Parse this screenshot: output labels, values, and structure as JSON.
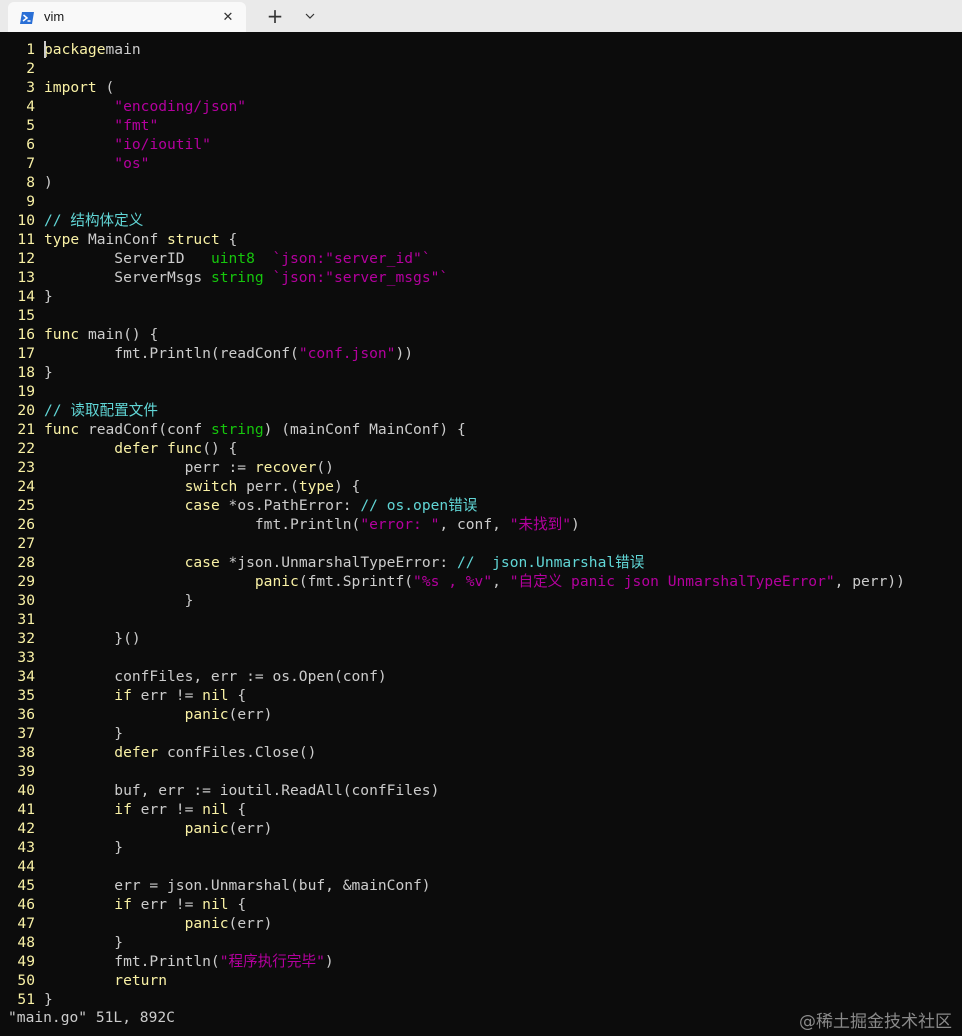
{
  "window": {
    "tab_title": "vim",
    "tab_icon": "powershell-icon",
    "close_glyph": "✕",
    "new_tab_glyph": "+",
    "dropdown_icon": "chevron-down-icon"
  },
  "colors": {
    "background": "#0c0c0c",
    "foreground": "#cccccc",
    "line_number": "#f9f1a5",
    "keyword": "#f9f1a5",
    "string": "#b4009e",
    "type": "#16c60c",
    "comment": "#61d6d6",
    "titlebar": "#eaeaea"
  },
  "editor": {
    "file_status": "\"main.go\" 51L, 892C",
    "lines": [
      [
        [
          "kw",
          "package"
        ],
        [
          "",
          "main"
        ]
      ],
      [],
      [
        [
          "kw",
          "import"
        ],
        [
          "",
          " ("
        ]
      ],
      [
        [
          "",
          "\t"
        ],
        [
          "str",
          "\"encoding/json\""
        ]
      ],
      [
        [
          "",
          "\t"
        ],
        [
          "str",
          "\"fmt\""
        ]
      ],
      [
        [
          "",
          "\t"
        ],
        [
          "str",
          "\"io/ioutil\""
        ]
      ],
      [
        [
          "",
          "\t"
        ],
        [
          "str",
          "\"os\""
        ]
      ],
      [
        [
          "",
          ")"
        ]
      ],
      [],
      [
        [
          "cm",
          "// 结构体定义"
        ]
      ],
      [
        [
          "kw",
          "type"
        ],
        [
          "",
          " MainConf "
        ],
        [
          "kw",
          "struct"
        ],
        [
          "",
          " {"
        ]
      ],
      [
        [
          "",
          "\tServerID   "
        ],
        [
          "ty",
          "uint8"
        ],
        [
          "",
          "  "
        ],
        [
          "str",
          "`json:\"server_id\"`"
        ]
      ],
      [
        [
          "",
          "\tServerMsgs "
        ],
        [
          "ty",
          "string"
        ],
        [
          "",
          " "
        ],
        [
          "str",
          "`json:\"server_msgs\"`"
        ]
      ],
      [
        [
          "",
          "}"
        ]
      ],
      [],
      [
        [
          "kw",
          "func"
        ],
        [
          "",
          " main() {"
        ]
      ],
      [
        [
          "",
          "\tfmt.Println(readConf("
        ],
        [
          "str",
          "\"conf.json\""
        ],
        [
          "",
          "))"
        ]
      ],
      [
        [
          "",
          "}"
        ]
      ],
      [],
      [
        [
          "cm",
          "// 读取配置文件"
        ]
      ],
      [
        [
          "kw",
          "func"
        ],
        [
          "",
          " readConf(conf "
        ],
        [
          "ty",
          "string"
        ],
        [
          "",
          ") (mainConf MainConf) {"
        ]
      ],
      [
        [
          "",
          "\t"
        ],
        [
          "kw",
          "defer"
        ],
        [
          "",
          " "
        ],
        [
          "kw",
          "func"
        ],
        [
          "",
          "() {"
        ]
      ],
      [
        [
          "",
          "\t\tperr := "
        ],
        [
          "kw",
          "recover"
        ],
        [
          "",
          "()"
        ]
      ],
      [
        [
          "",
          "\t\t"
        ],
        [
          "kw",
          "switch"
        ],
        [
          "",
          " perr.("
        ],
        [
          "kw",
          "type"
        ],
        [
          "",
          ") {"
        ]
      ],
      [
        [
          "",
          "\t\t"
        ],
        [
          "kw",
          "case"
        ],
        [
          "",
          " *os.PathError: "
        ],
        [
          "cm",
          "// os.open错误"
        ]
      ],
      [
        [
          "",
          "\t\t\tfmt.Println("
        ],
        [
          "str",
          "\"error: \""
        ],
        [
          "",
          ", conf, "
        ],
        [
          "str",
          "\"未找到\""
        ],
        [
          "",
          ")"
        ]
      ],
      [],
      [
        [
          "",
          "\t\t"
        ],
        [
          "kw",
          "case"
        ],
        [
          "",
          " *json.UnmarshalTypeError: "
        ],
        [
          "cm",
          "//  json.Unmarshal错误"
        ]
      ],
      [
        [
          "",
          "\t\t\t"
        ],
        [
          "kw",
          "panic"
        ],
        [
          "",
          "(fmt.Sprintf("
        ],
        [
          "str",
          "\"%s , %v\""
        ],
        [
          "",
          ", "
        ],
        [
          "str",
          "\"自定义 panic json UnmarshalTypeError\""
        ],
        [
          "",
          ", perr))"
        ]
      ],
      [
        [
          "",
          "\t\t}"
        ]
      ],
      [],
      [
        [
          "",
          "\t}()"
        ]
      ],
      [],
      [
        [
          "",
          "\tconfFiles, err := os.Open(conf)"
        ]
      ],
      [
        [
          "",
          "\t"
        ],
        [
          "kw",
          "if"
        ],
        [
          "",
          " err != "
        ],
        [
          "kw",
          "nil"
        ],
        [
          "",
          " {"
        ]
      ],
      [
        [
          "",
          "\t\t"
        ],
        [
          "kw",
          "panic"
        ],
        [
          "",
          "(err)"
        ]
      ],
      [
        [
          "",
          "\t}"
        ]
      ],
      [
        [
          "",
          "\t"
        ],
        [
          "kw",
          "defer"
        ],
        [
          "",
          " confFiles.Close()"
        ]
      ],
      [],
      [
        [
          "",
          "\tbuf, err := ioutil.ReadAll(confFiles)"
        ]
      ],
      [
        [
          "",
          "\t"
        ],
        [
          "kw",
          "if"
        ],
        [
          "",
          " err != "
        ],
        [
          "kw",
          "nil"
        ],
        [
          "",
          " {"
        ]
      ],
      [
        [
          "",
          "\t\t"
        ],
        [
          "kw",
          "panic"
        ],
        [
          "",
          "(err)"
        ]
      ],
      [
        [
          "",
          "\t}"
        ]
      ],
      [],
      [
        [
          "",
          "\terr = json.Unmarshal(buf, &mainConf)"
        ]
      ],
      [
        [
          "",
          "\t"
        ],
        [
          "kw",
          "if"
        ],
        [
          "",
          " err != "
        ],
        [
          "kw",
          "nil"
        ],
        [
          "",
          " {"
        ]
      ],
      [
        [
          "",
          "\t\t"
        ],
        [
          "kw",
          "panic"
        ],
        [
          "",
          "(err)"
        ]
      ],
      [
        [
          "",
          "\t}"
        ]
      ],
      [
        [
          "",
          "\tfmt.Println("
        ],
        [
          "str",
          "\"程序执行完毕\""
        ],
        [
          "",
          ")"
        ]
      ],
      [
        [
          "",
          "\t"
        ],
        [
          "kw",
          "return"
        ]
      ],
      [
        [
          "",
          "}"
        ]
      ]
    ]
  },
  "watermark": "@稀土掘金技术社区"
}
